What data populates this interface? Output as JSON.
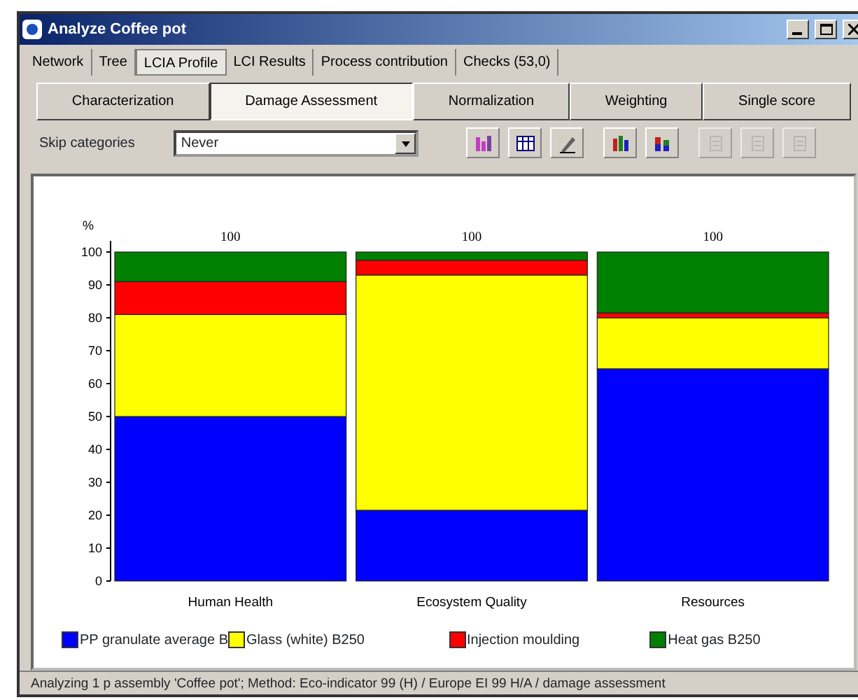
{
  "window": {
    "title": "Analyze Coffee pot"
  },
  "tabs": [
    {
      "label": "Network",
      "selected": false
    },
    {
      "label": "Tree",
      "selected": false
    },
    {
      "label": "LCIA Profile",
      "selected": true
    },
    {
      "label": "LCI Results",
      "selected": false
    },
    {
      "label": "Process contribution",
      "selected": false
    },
    {
      "label": "Checks (53,0)",
      "selected": false
    }
  ],
  "subtabs": [
    {
      "label": "Characterization",
      "selected": false
    },
    {
      "label": "Damage Assessment",
      "selected": true
    },
    {
      "label": "Normalization",
      "selected": false
    },
    {
      "label": "Weighting",
      "selected": false
    },
    {
      "label": "Single score",
      "selected": false
    }
  ],
  "skip_categories": {
    "label": "Skip categories",
    "value": "Never"
  },
  "toolbar": [
    {
      "kind": "chart",
      "disabled": false
    },
    {
      "kind": "table",
      "disabled": false
    },
    {
      "kind": "pen",
      "disabled": false
    },
    {
      "kind": "bars",
      "disabled": false
    },
    {
      "kind": "stack",
      "disabled": false
    },
    {
      "kind": "plain",
      "disabled": true
    },
    {
      "kind": "plain",
      "disabled": true
    },
    {
      "kind": "plain",
      "disabled": true
    }
  ],
  "chart_data": {
    "type": "bar",
    "stacked": true,
    "ylabel": "%",
    "categories": [
      "Human Health",
      "Ecosystem Quality",
      "Resources"
    ],
    "series": [
      {
        "name": "PP granulate average B",
        "color": "#0000ff",
        "values": [
          50,
          21.5,
          64.5
        ]
      },
      {
        "name": "Glass (white) B250",
        "color": "#ffff00",
        "values": [
          31,
          71.5,
          15.5
        ]
      },
      {
        "name": "Injection moulding",
        "color": "#ff0000",
        "values": [
          10,
          4.5,
          1.5
        ]
      },
      {
        "name": "Heat gas B250",
        "color": "#008000",
        "values": [
          9,
          2.5,
          18.5
        ]
      }
    ],
    "ylim": [
      0,
      100
    ],
    "yticks": [
      0,
      10,
      20,
      30,
      40,
      50,
      60,
      70,
      80,
      90,
      100
    ],
    "value_labels": [
      "100",
      "100",
      "100"
    ]
  },
  "status_bar": "Analyzing 1 p assembly 'Coffee pot'; Method: Eco-indicator 99 (H) / Europe EI 99 H/A / damage assessment"
}
